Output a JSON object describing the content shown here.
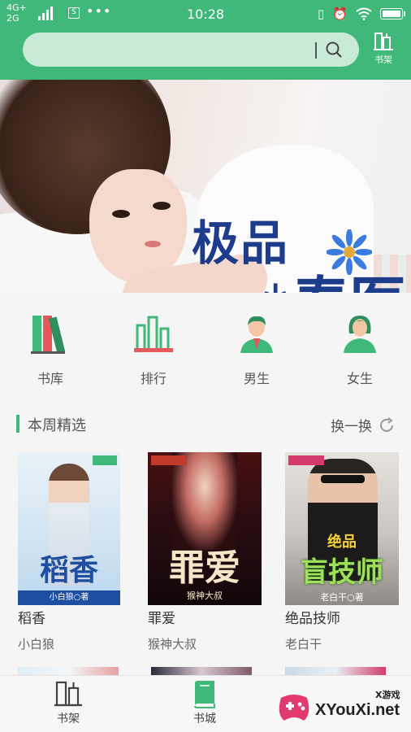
{
  "status_bar": {
    "network_top": "4G+",
    "network_bottom": "2G",
    "sim_icon": "sim-icon",
    "more_icon": "•••",
    "time": "10:28"
  },
  "header": {
    "search_placeholder": "",
    "shelf_label": "书架",
    "accent_color": "#3fb879"
  },
  "banner": {
    "title_line1": "极品",
    "title_line2_small": "小",
    "title_line2_large": "春医",
    "active_dot": 0,
    "dot_count": 2
  },
  "categories": [
    {
      "label": "书库",
      "icon": "books-icon"
    },
    {
      "label": "排行",
      "icon": "ranking-icon"
    },
    {
      "label": "男生",
      "icon": "male-icon"
    },
    {
      "label": "女生",
      "icon": "female-icon"
    }
  ],
  "section": {
    "title": "本周精选",
    "refresh_label": "换一换"
  },
  "books": [
    {
      "title": "稻香",
      "author": "小白狼",
      "cover_title": "稻香",
      "cover_caption": "小白狼○著"
    },
    {
      "title": "罪爱",
      "author": "猴神大叔",
      "cover_title": "罪爱",
      "cover_caption": "猴神大叔"
    },
    {
      "title": "绝品技师",
      "author": "老白干",
      "cover_title_small": "绝品",
      "cover_title": "盲技师",
      "cover_caption": "老白干○著"
    }
  ],
  "bottom_nav": [
    {
      "label": "书架",
      "icon": "bookshelf-icon",
      "active": false
    },
    {
      "label": "书城",
      "icon": "bookstore-icon",
      "active": true
    }
  ],
  "watermark": {
    "small": "X游戏",
    "main": "XYouXi.net"
  }
}
